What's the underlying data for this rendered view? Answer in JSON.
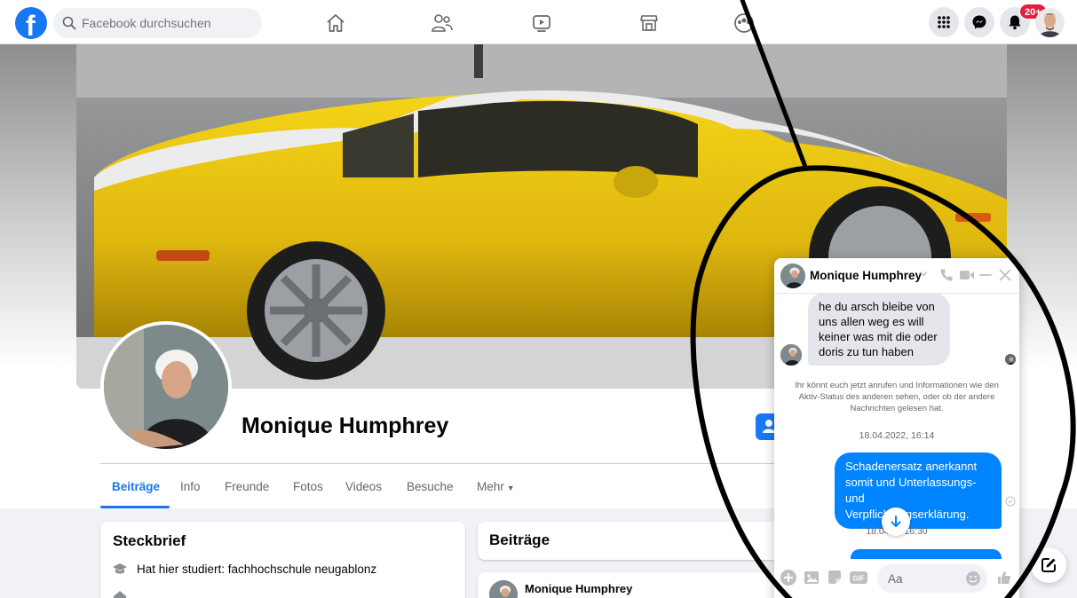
{
  "topbar": {
    "logo_letter": "f",
    "search_placeholder": "Facebook durchsuchen",
    "notification_count": "20+"
  },
  "profile": {
    "name": "Monique Humphrey",
    "tabs": [
      "Beiträge",
      "Info",
      "Freunde",
      "Fotos",
      "Videos",
      "Besuche",
      "Mehr"
    ],
    "active_tab": "Beiträge"
  },
  "intro": {
    "title": "Steckbrief",
    "studied": "Hat hier studiert: fachhochschule neugablonz"
  },
  "posts": {
    "title": "Beiträge",
    "first_author": "Monique Humphrey"
  },
  "chat": {
    "contact_name": "Monique Humphrey",
    "incoming_message": "he du arsch bleibe von uns allen weg es will keiner was mit die oder doris zu tun haben",
    "info_notice": "Ihr könnt euch jetzt anrufen und Informationen wie den Aktiv-Status des anderen sehen, oder ob der andere Nachrichten gelesen hat.",
    "timestamp_1": "18.04.2022, 16:14",
    "outgoing_message": "Schadenersatz anerkannt somit und Unterlassungs- und Verpflichtungserklärung.",
    "timestamp_2_left": "18.04.",
    "timestamp_2_right": ", 16:30",
    "input_placeholder": "Aa"
  },
  "colors": {
    "brand_blue": "#1877f2",
    "messenger_blue": "#0084ff",
    "badge_red": "#e41e3f",
    "car_yellow": "#e6c419"
  }
}
